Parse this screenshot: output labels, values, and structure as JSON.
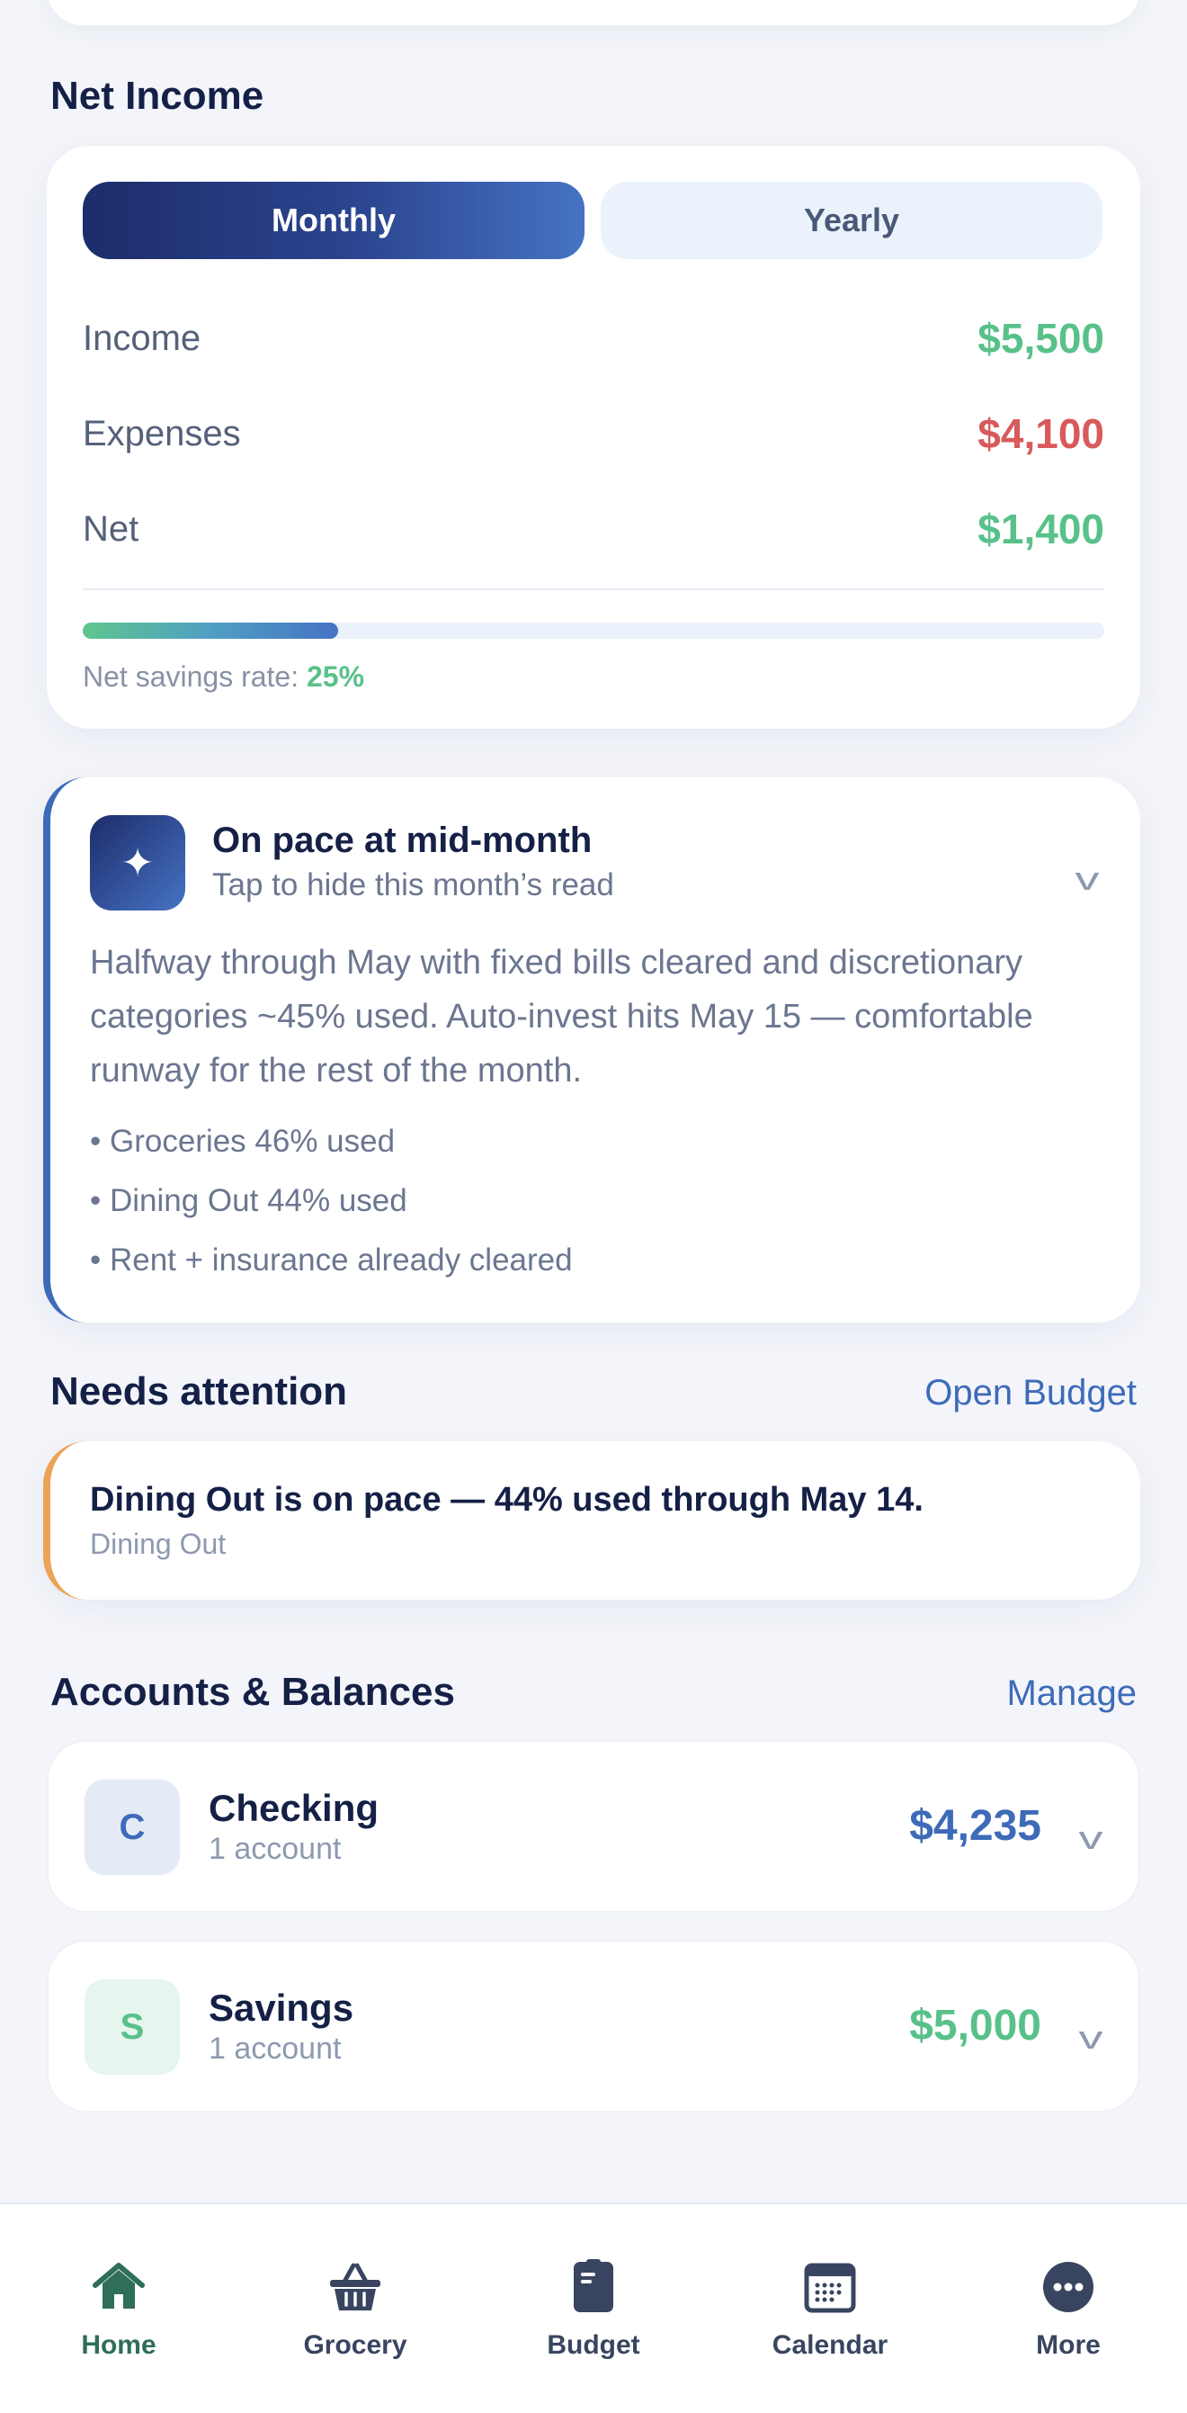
{
  "net_income": {
    "title": "Net Income",
    "tabs": {
      "monthly": "Monthly",
      "yearly": "Yearly"
    },
    "rows": [
      {
        "label": "Income",
        "value": "$5,500"
      },
      {
        "label": "Expenses",
        "value": "$4,100"
      },
      {
        "label": "Net",
        "value": "$1,400"
      }
    ],
    "savings_rate_label": "Net savings rate:",
    "savings_rate_value": "25%",
    "savings_rate_fraction": 0.25
  },
  "insight": {
    "title": "On pace at mid-month",
    "subtitle": "Tap to hide this month’s read",
    "body": "Halfway through May with fixed bills cleared and discretionary categories ~45% used. Auto-invest hits May 15 — comfortable runway for the rest of the month.",
    "bullets": [
      "• Groceries 46% used",
      "• Dining Out 44% used",
      "• Rent + insurance already cleared"
    ]
  },
  "attention": {
    "title": "Needs attention",
    "link": "Open Budget",
    "item_title": "Dining Out is on pace — 44% used through May 14.",
    "item_category": "Dining Out"
  },
  "accounts": {
    "title": "Accounts & Balances",
    "link": "Manage",
    "items": [
      {
        "initial": "C",
        "name": "Checking",
        "count": "1 account",
        "balance": "$4,235"
      },
      {
        "initial": "S",
        "name": "Savings",
        "count": "1 account",
        "balance": "$5,000"
      }
    ]
  },
  "tabbar": {
    "items": [
      {
        "label": "Home",
        "icon": "home-icon"
      },
      {
        "label": "Grocery",
        "icon": "basket-icon"
      },
      {
        "label": "Budget",
        "icon": "clipboard-icon"
      },
      {
        "label": "Calendar",
        "icon": "calendar-icon"
      },
      {
        "label": "More",
        "icon": "more-icon"
      }
    ],
    "active": "Home"
  },
  "colors": {
    "positive": "#58c18a",
    "negative": "#d85a5a",
    "accent": "#3e6bb8",
    "warning": "#eba356",
    "navy": "#1d2c6a"
  }
}
